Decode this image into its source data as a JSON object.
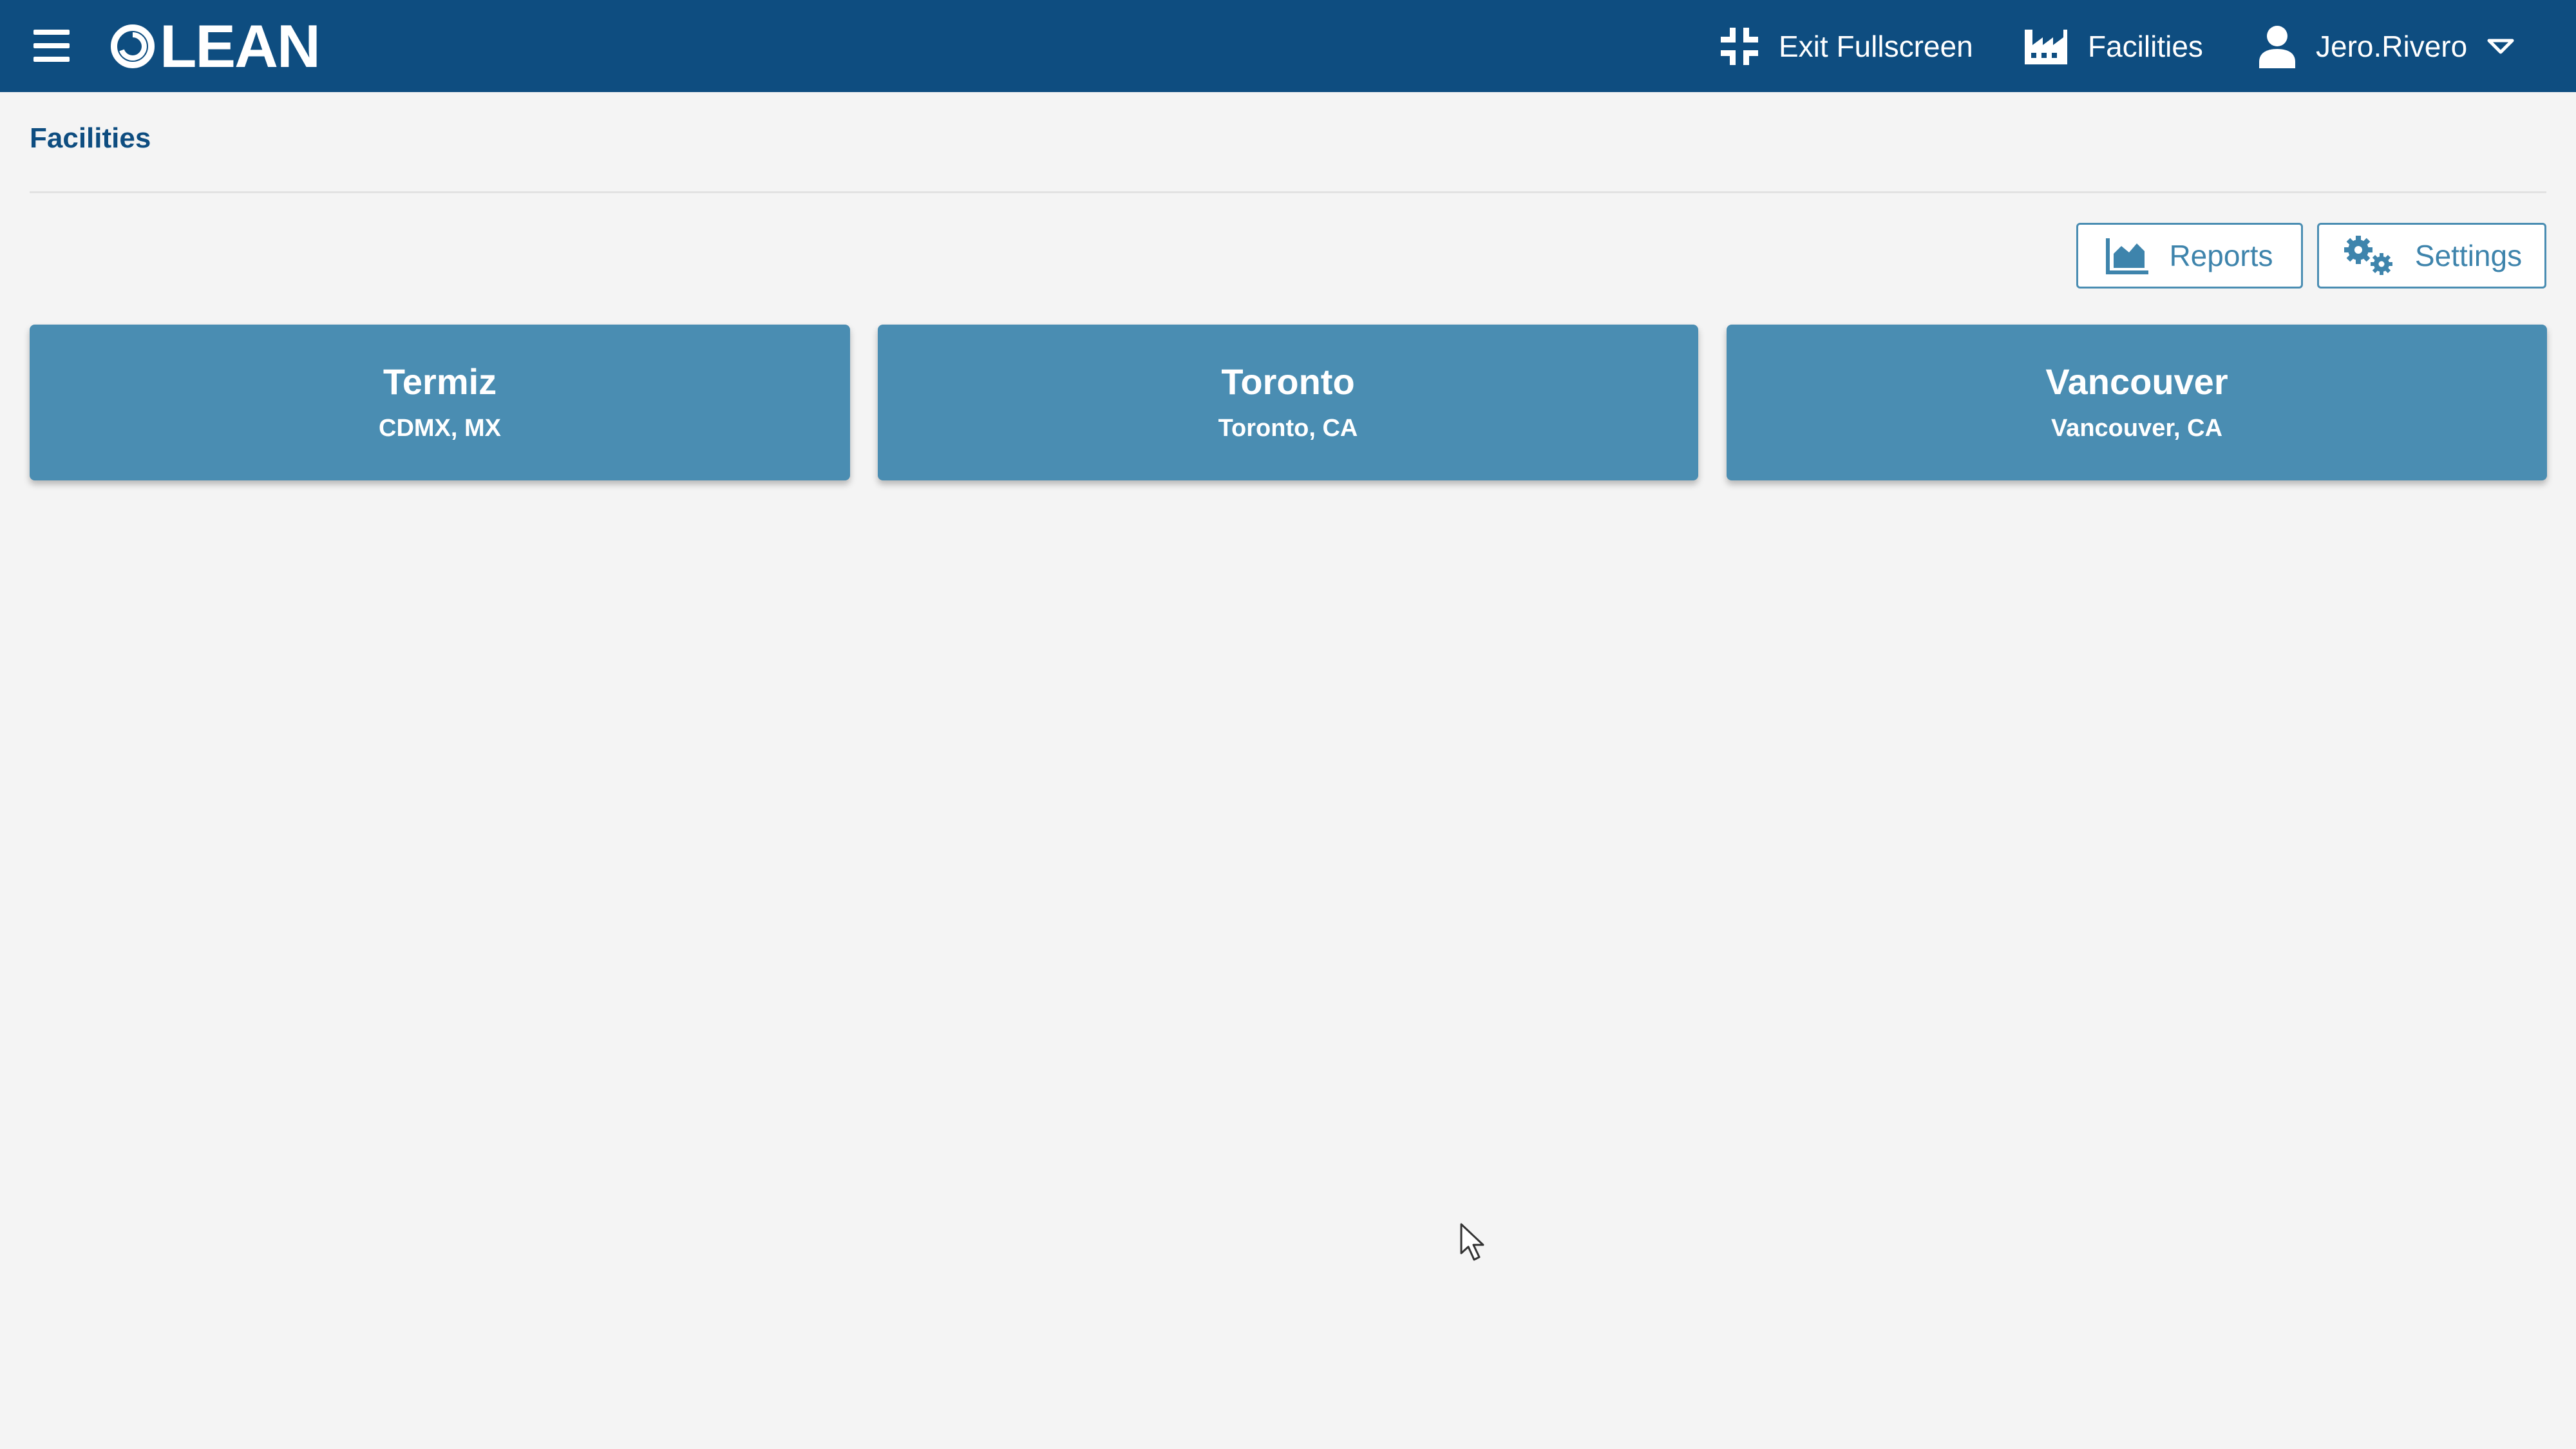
{
  "header": {
    "logo_text": "LEAN",
    "exit_fullscreen_label": "Exit Fullscreen",
    "facilities_label": "Facilities",
    "user_name": "Jero.Rivero"
  },
  "page": {
    "breadcrumb": "Facilities"
  },
  "toolbar": {
    "reports_label": "Reports",
    "settings_label": "Settings"
  },
  "facilities": [
    {
      "name": "Termiz",
      "location": "CDMX, MX"
    },
    {
      "name": "Toronto",
      "location": "Toronto, CA"
    },
    {
      "name": "Vancouver",
      "location": "Vancouver, CA"
    }
  ],
  "colors": {
    "header_bg": "#0e4d80",
    "card_bg": "#4a8db2",
    "page_bg": "#f4f4f4",
    "accent_text": "#3e84ac"
  }
}
